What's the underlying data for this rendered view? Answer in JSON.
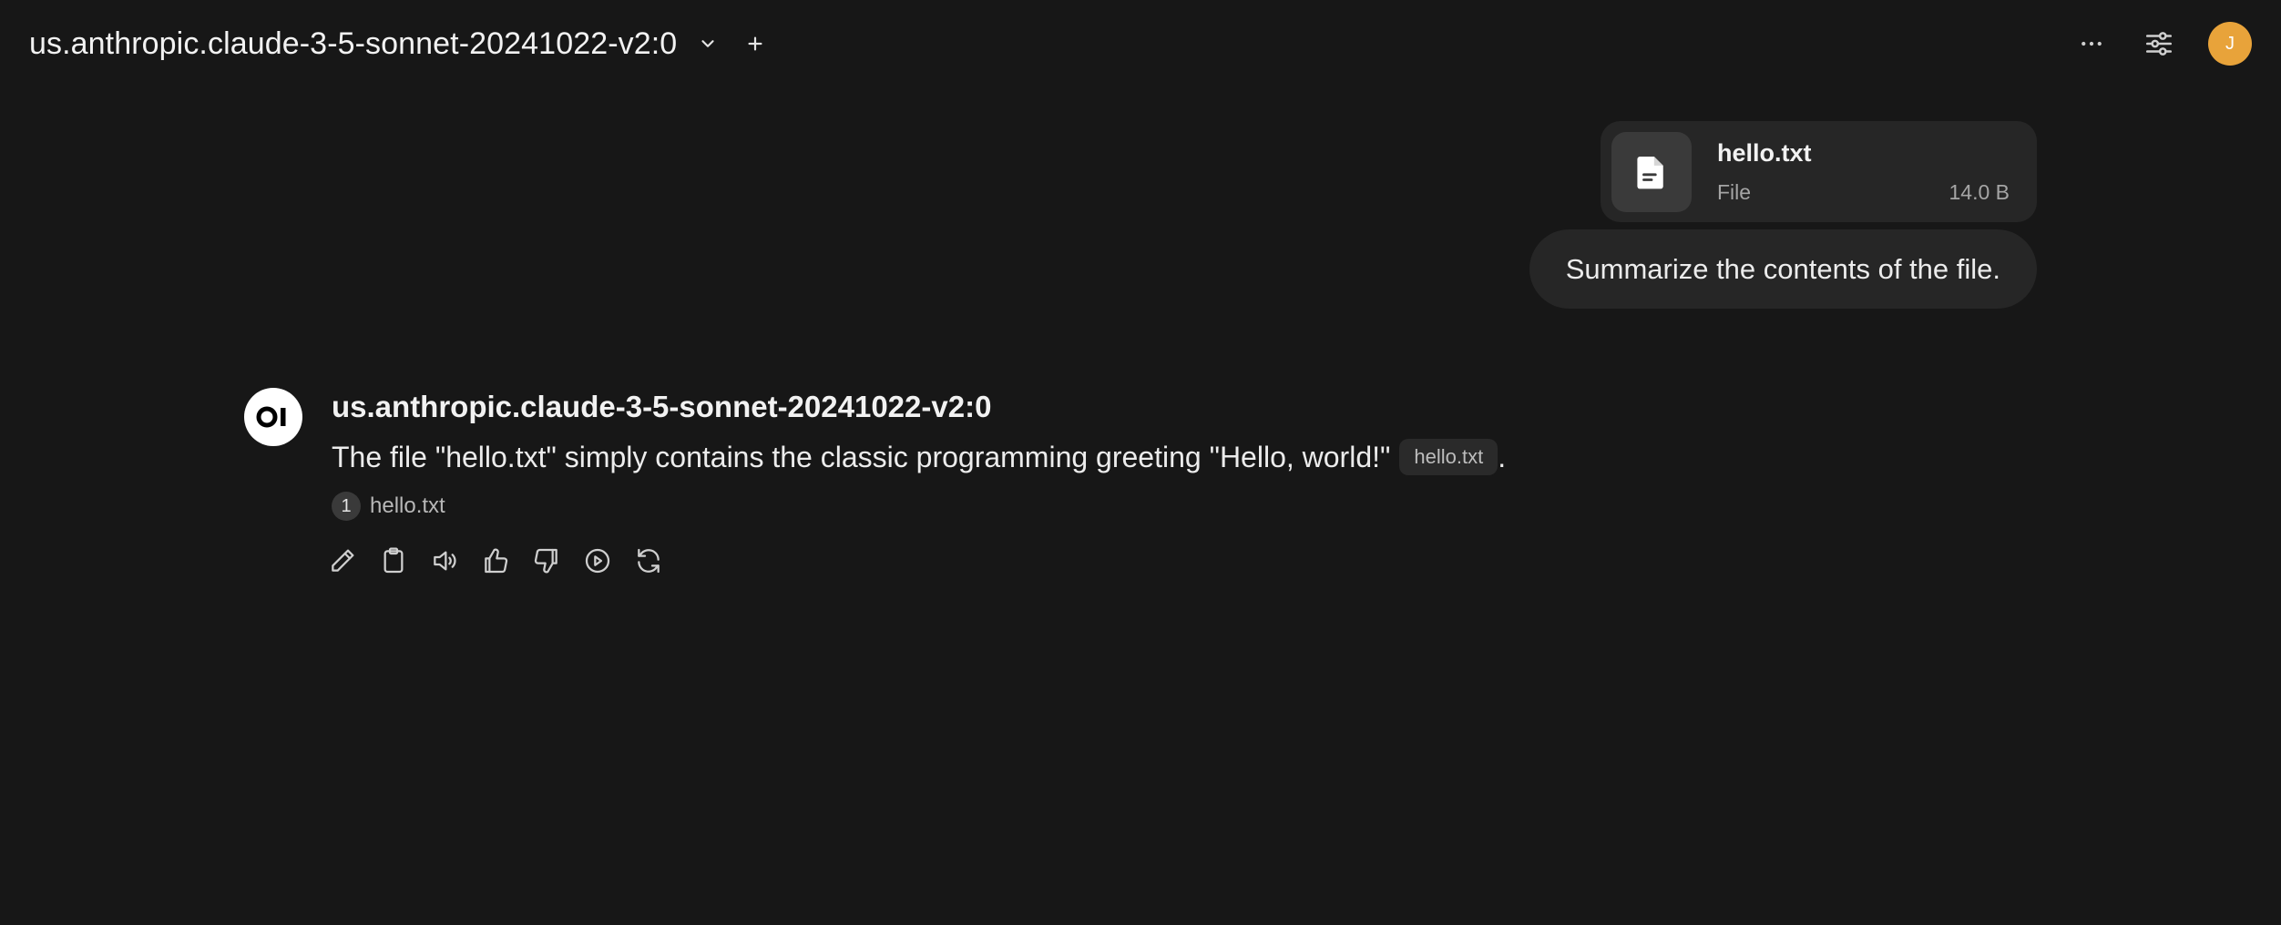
{
  "header": {
    "model_name": "us.anthropic.claude-3-5-sonnet-20241022-v2:0",
    "avatar_initial": "J",
    "avatar_color": "#e8a33a"
  },
  "user_message": {
    "file": {
      "name": "hello.txt",
      "type": "File",
      "size": "14.0 B"
    },
    "text": "Summarize the contents of the file."
  },
  "assistant_message": {
    "model_name": "us.anthropic.claude-3-5-sonnet-20241022-v2:0",
    "text": "The file \"hello.txt\" simply contains the classic programming greeting \"Hello, world!\"",
    "citation_chip": "hello.txt",
    "trailing": ".",
    "sources": [
      {
        "index": "1",
        "name": "hello.txt"
      }
    ],
    "actions": [
      "edit-icon",
      "copy-icon",
      "read-aloud-icon",
      "thumbs-up-icon",
      "thumbs-down-icon",
      "continue-icon",
      "regenerate-icon"
    ]
  }
}
